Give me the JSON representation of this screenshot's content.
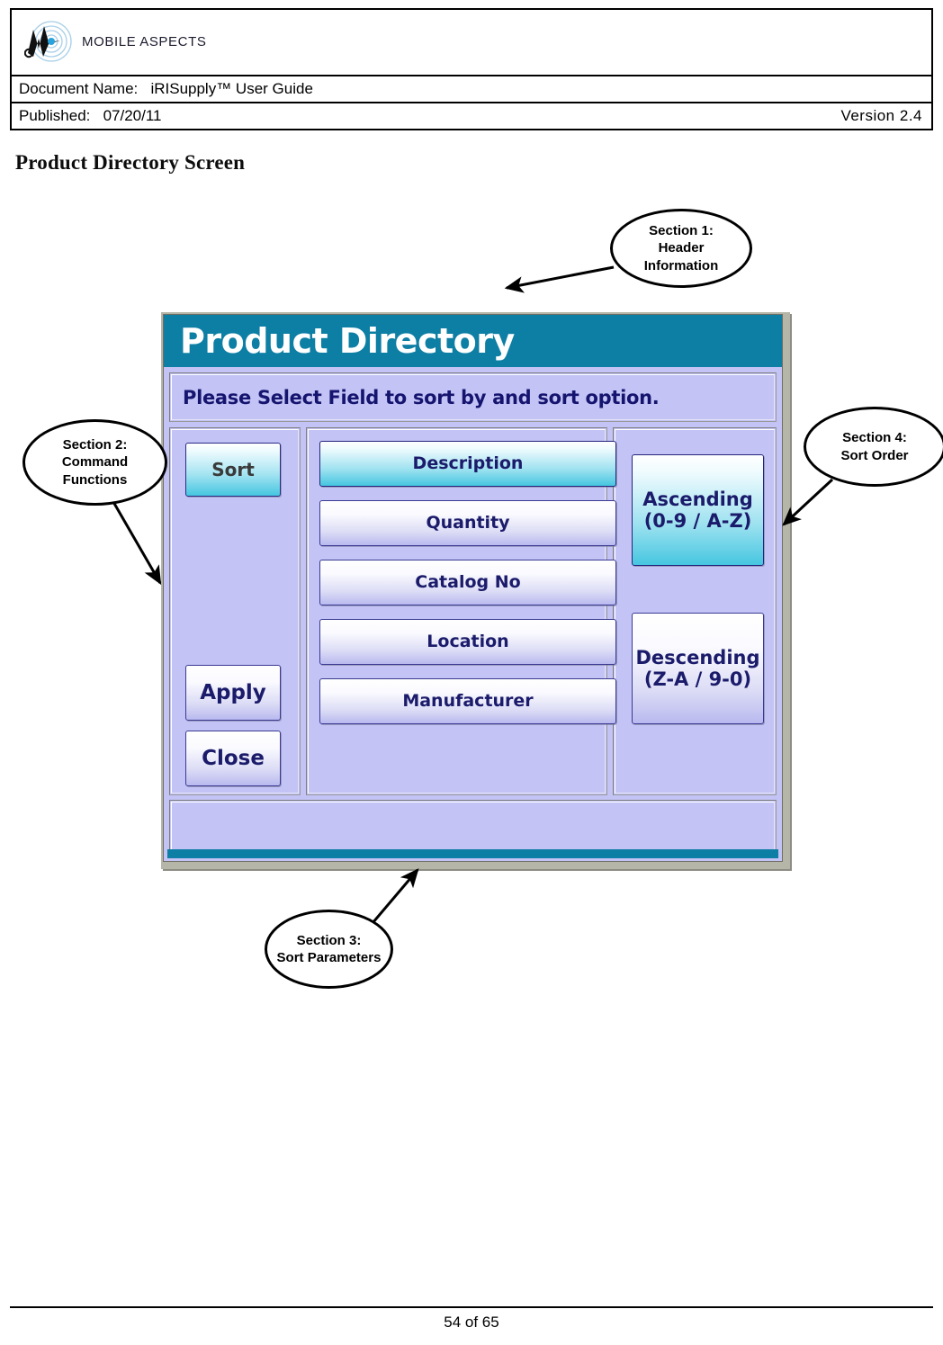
{
  "doc_header": {
    "logo_text": "MOBILE ASPECTS",
    "document_name_label": "Document Name:",
    "document_name_value": "iRISupply™ User Guide",
    "published_label": "Published:",
    "published_value": "07/20/11",
    "version": "Version 2.4"
  },
  "page": {
    "heading": "Product Directory Screen",
    "footer": "54 of 65"
  },
  "app": {
    "title": "Product Directory",
    "prompt": "Please Select Field to sort by and sort option.",
    "accent_color": "#0d7ea4",
    "body_color": "#c3c3f5",
    "selected_color": "#46c6e0",
    "commands": [
      {
        "label": "Sort",
        "state": "active"
      },
      {
        "label": "Apply",
        "state": "normal"
      },
      {
        "label": "Close",
        "state": "normal"
      }
    ],
    "sort_fields": [
      {
        "label": "Description",
        "selected": true
      },
      {
        "label": "Quantity",
        "selected": false
      },
      {
        "label": "Catalog No",
        "selected": false
      },
      {
        "label": "Location",
        "selected": false
      },
      {
        "label": "Manufacturer",
        "selected": false
      }
    ],
    "sort_order": [
      {
        "line1": "Ascending",
        "line2": "(0-9 / A-Z)",
        "selected": true
      },
      {
        "line1": "Descending",
        "line2": "(Z-A / 9-0)",
        "selected": false
      }
    ]
  },
  "callouts": [
    {
      "id": "section-1",
      "lines": [
        "Section 1:",
        "Header",
        "Information"
      ]
    },
    {
      "id": "section-2",
      "lines": [
        "Section 2:",
        "Command",
        "Functions"
      ]
    },
    {
      "id": "section-3",
      "lines": [
        "Section 3:",
        "Sort Parameters"
      ]
    },
    {
      "id": "section-4",
      "lines": [
        "Section 4:",
        "Sort Order"
      ]
    }
  ]
}
